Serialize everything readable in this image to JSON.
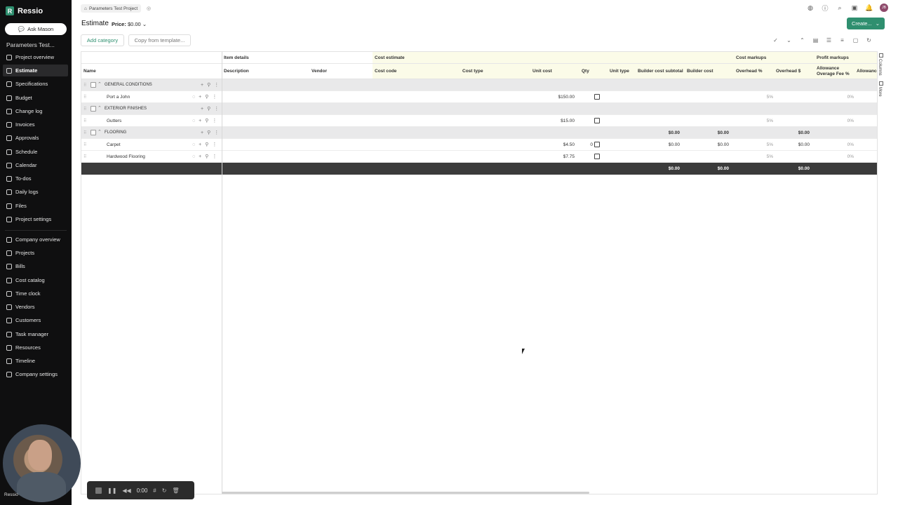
{
  "app": {
    "name": "Ressio"
  },
  "sidebar": {
    "ask_button": "Ask Mason",
    "project_title": "Parameters Test...",
    "project_items": [
      {
        "label": "Project overview"
      },
      {
        "label": "Estimate",
        "active": true
      },
      {
        "label": "Specifications"
      },
      {
        "label": "Budget"
      },
      {
        "label": "Change log"
      },
      {
        "label": "Invoices"
      },
      {
        "label": "Approvals"
      },
      {
        "label": "Schedule"
      },
      {
        "label": "Calendar"
      },
      {
        "label": "To-dos"
      },
      {
        "label": "Daily logs"
      },
      {
        "label": "Files"
      },
      {
        "label": "Project settings"
      }
    ],
    "company_items": [
      {
        "label": "Company overview"
      },
      {
        "label": "Projects"
      },
      {
        "label": "Bills"
      },
      {
        "label": "Cost catalog"
      },
      {
        "label": "Time clock"
      },
      {
        "label": "Vendors"
      },
      {
        "label": "Customers"
      },
      {
        "label": "Task manager"
      },
      {
        "label": "Resources"
      },
      {
        "label": "Timeline"
      },
      {
        "label": "Company settings"
      }
    ],
    "webcam_label": "Ressio"
  },
  "header": {
    "breadcrumb": "Parameters Test Project",
    "page_title": "Estimate",
    "price_label": "Price:",
    "price_value": "$0.00",
    "create_button": "Create...",
    "avatar_initials": "JB",
    "icons": [
      "help-chat-icon",
      "info-icon",
      "search-icon",
      "messages-icon",
      "notifications-icon"
    ]
  },
  "toolbar": {
    "add_category": "Add category",
    "copy_template": "Copy from template...",
    "icons": [
      "check-circle-icon",
      "collapse-icon",
      "expand-icon",
      "columns-icon",
      "filter-icon",
      "density-icon",
      "lock-icon",
      "history-icon"
    ]
  },
  "grid": {
    "group_headers": {
      "item_details": "Item details",
      "cost_estimate": "Cost estimate",
      "cost_markups": "Cost markups",
      "profit_markups": "Profit markups"
    },
    "columns": {
      "name": "Name",
      "description": "Description",
      "vendor": "Vendor",
      "cost_code": "Cost code",
      "cost_type": "Cost type",
      "unit_cost": "Unit cost",
      "qty": "Qty",
      "unit_type": "Unit type",
      "builder_cost_subtotal": "Builder cost subtotal",
      "builder_cost": "Builder cost",
      "overhead_pct": "Overhead %",
      "overhead_amt": "Overhead $",
      "allowance_fee_pct": "Allowance Overage Fee %",
      "allowance_cut": "Allowance Overage F"
    },
    "rows": [
      {
        "type": "category",
        "name": "GENERAL CONDITIONS"
      },
      {
        "type": "item",
        "name": "Port a John",
        "unit_cost": "$150.00",
        "overhead_pct": "5%",
        "allowance_pct": "0%"
      },
      {
        "type": "category",
        "name": "EXTERIOR FINISHES"
      },
      {
        "type": "item",
        "name": "Gutters",
        "unit_cost": "$15.00",
        "overhead_pct": "5%",
        "allowance_pct": "0%"
      },
      {
        "type": "category",
        "name": "FLOORING",
        "subtotal": "$0.00",
        "builder_cost": "$0.00",
        "overhead_amt": "$0.00"
      },
      {
        "type": "item",
        "name": "Carpet",
        "unit_cost": "$4.50",
        "qty": "0",
        "subtotal": "$0.00",
        "builder_cost": "$0.00",
        "overhead_pct": "5%",
        "overhead_amt": "$0.00",
        "allowance_pct": "0%"
      },
      {
        "type": "item",
        "name": "Hardwood Flooring",
        "unit_cost": "$7.75",
        "overhead_pct": "5%",
        "allowance_pct": "0%"
      }
    ],
    "totals": {
      "subtotal": "$0.00",
      "builder_cost": "$0.00",
      "overhead_amt": "$0.00"
    },
    "side_tabs": [
      "Columns",
      "More"
    ]
  },
  "recorder": {
    "time": "0:00"
  }
}
